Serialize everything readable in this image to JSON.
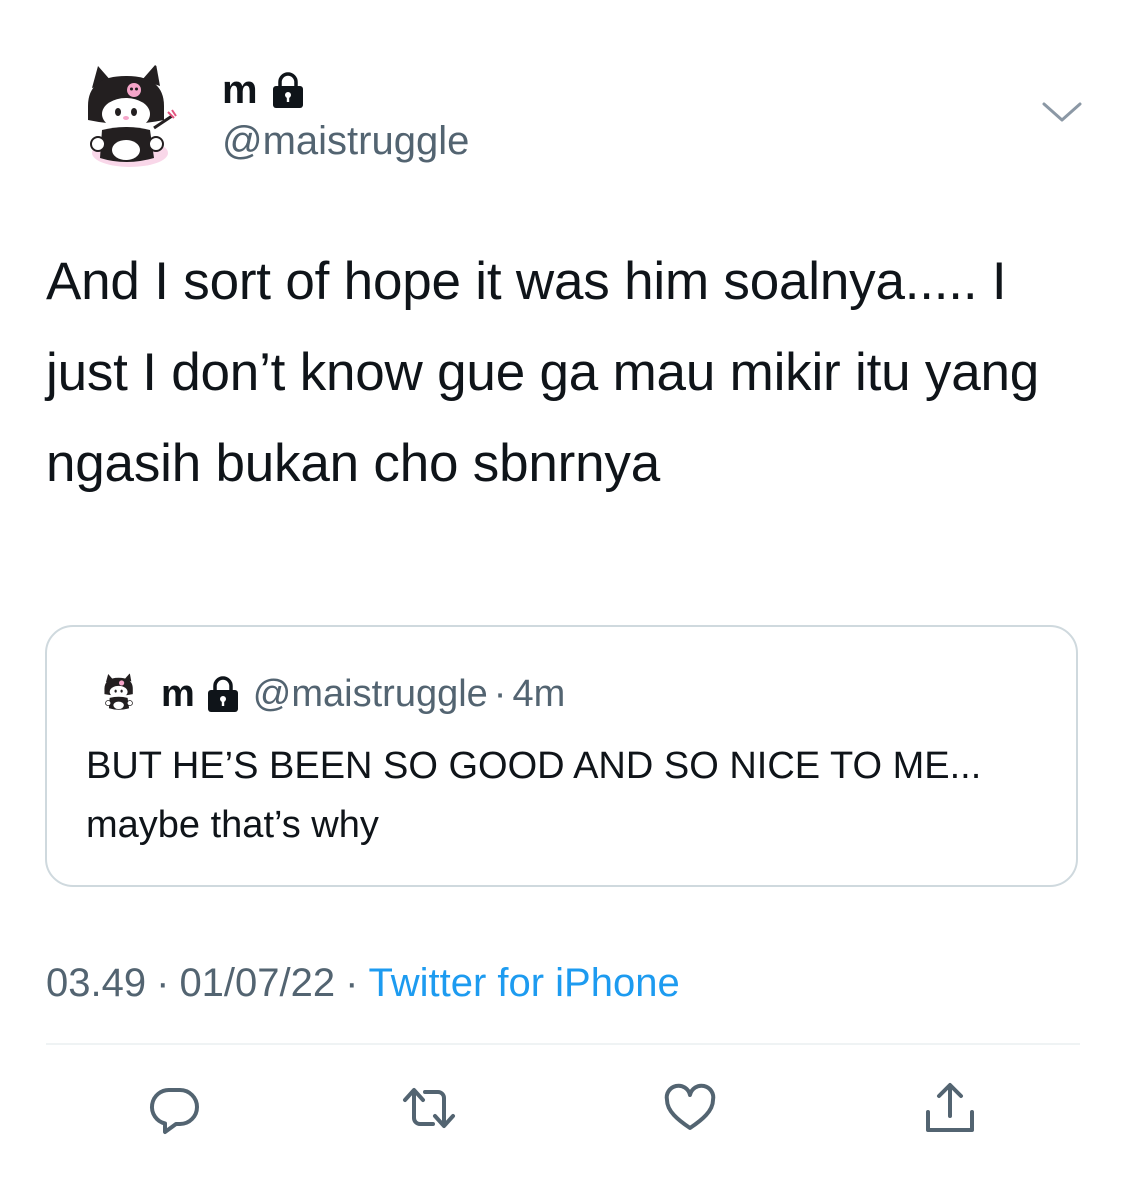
{
  "tweet": {
    "author": {
      "display_name": "m",
      "handle": "@maistruggle",
      "protected_icon": "lock-icon",
      "avatar_icon": "kuromi-avatar"
    },
    "text": "And I sort of hope it was him soalnya..... I just I don’t know gue ga mau mikir itu yang ngasih bukan cho sbnrnya",
    "quoted": {
      "display_name": "m",
      "handle": "@maistruggle",
      "separator": "·",
      "time": "4m",
      "text": "BUT HE’S BEEN SO GOOD AND SO NICE TO ME... maybe that’s why"
    },
    "meta": {
      "time": "03.49",
      "separator": "·",
      "date": "01/07/22",
      "source": "Twitter for iPhone"
    },
    "actions": {
      "reply_icon": "reply-icon",
      "retweet_icon": "retweet-icon",
      "like_icon": "heart-icon",
      "share_icon": "share-icon"
    },
    "colors": {
      "text": "#0f1419",
      "secondary": "#536471",
      "link": "#1d9bf0",
      "border": "#cfd9de"
    }
  }
}
